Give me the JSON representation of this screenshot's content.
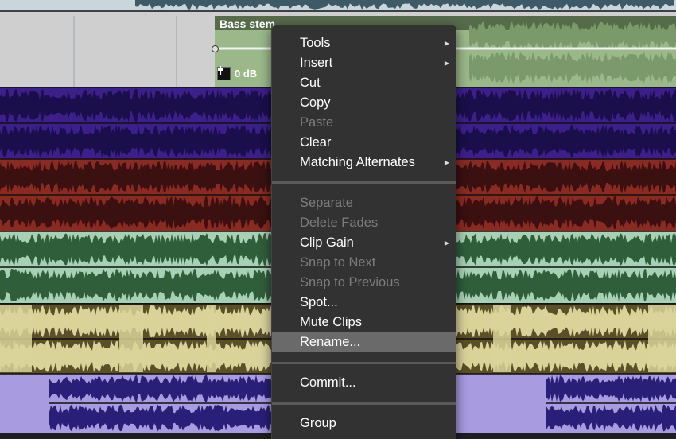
{
  "clip": {
    "name": "Bass stem",
    "gain": "0 dB"
  },
  "tracks": [
    {
      "color": "#cfcfcf",
      "wave": "#6a8a96"
    },
    {
      "color": "#3c1f8a",
      "wave": "#1a0f4a"
    },
    {
      "color": "#8b2a20",
      "wave": "#3a1010"
    },
    {
      "color": "#a7d1b5",
      "wave": "#2f5e3b"
    },
    {
      "color": "#5a4f26",
      "wave": "#d9d39a"
    },
    {
      "color": "#a89be0",
      "wave": "#2a1f78"
    }
  ],
  "menu": {
    "items": [
      {
        "label": "Tools",
        "submenu": true,
        "enabled": true
      },
      {
        "label": "Insert",
        "submenu": true,
        "enabled": true
      },
      {
        "label": "Cut",
        "submenu": false,
        "enabled": true
      },
      {
        "label": "Copy",
        "submenu": false,
        "enabled": true
      },
      {
        "label": "Paste",
        "submenu": false,
        "enabled": false
      },
      {
        "label": "Clear",
        "submenu": false,
        "enabled": true
      },
      {
        "label": "Matching Alternates",
        "submenu": true,
        "enabled": true
      },
      {
        "label": "Separate",
        "submenu": false,
        "enabled": false
      },
      {
        "label": "Delete Fades",
        "submenu": false,
        "enabled": false
      },
      {
        "label": "Clip Gain",
        "submenu": true,
        "enabled": true
      },
      {
        "label": "Snap to Next",
        "submenu": false,
        "enabled": false
      },
      {
        "label": "Snap to Previous",
        "submenu": false,
        "enabled": false
      },
      {
        "label": "Spot...",
        "submenu": false,
        "enabled": true
      },
      {
        "label": "Mute Clips",
        "submenu": false,
        "enabled": true
      },
      {
        "label": "Rename...",
        "submenu": false,
        "enabled": true,
        "highlighted": true
      },
      {
        "label": "Commit...",
        "submenu": false,
        "enabled": true
      },
      {
        "label": "Group",
        "submenu": false,
        "enabled": true
      }
    ],
    "submenu_arrow": "▶"
  }
}
